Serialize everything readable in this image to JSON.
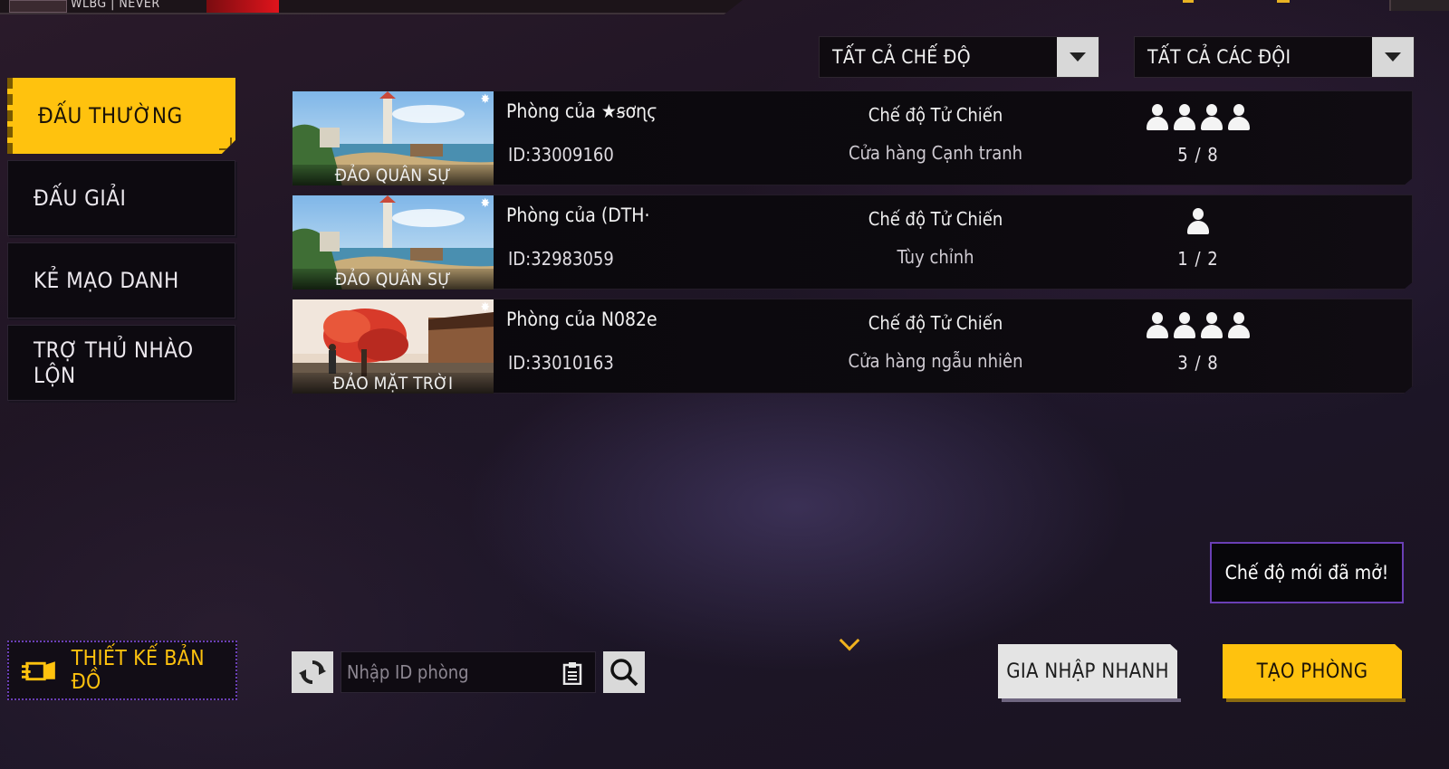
{
  "top_bar": {
    "name_text": "WLBG | NEVER"
  },
  "filters": {
    "mode": {
      "label": "TẤT CẢ CHẾ ĐỘ"
    },
    "team": {
      "label": "TẤT CẢ CÁC ĐỘI"
    }
  },
  "tabs": [
    {
      "label": "ĐẤU THƯỜNG",
      "active": true
    },
    {
      "label": "ĐẤU GIẢI",
      "active": false
    },
    {
      "label": "KẺ MẠO DANH",
      "active": false
    },
    {
      "label": "TRỢ THỦ NHÀO LỘN",
      "active": false
    }
  ],
  "rooms": [
    {
      "map": "ĐẢO QUÂN SỰ",
      "name": "Phòng của ★ꞩơɳϛ",
      "id": "ID:33009160",
      "mode": "Chế độ Tử Chiến",
      "shop": "Cửa hàng Cạnh tranh",
      "players": "5 / 8",
      "icon_count": 4
    },
    {
      "map": "ĐẢO QUÂN SỰ",
      "name": "Phòng của (DTH·",
      "id": "ID:32983059",
      "mode": "Chế độ Tử Chiến",
      "shop": "Tùy chỉnh",
      "players": "1 / 2",
      "icon_count": 1
    },
    {
      "map": "ĐẢO MẶT TRỜI",
      "name": "Phòng của N082e",
      "id": "ID:33010163",
      "mode": "Chế độ Tử Chiến",
      "shop": "Cửa hàng ngẫu nhiên",
      "players": "3 / 8",
      "icon_count": 4
    }
  ],
  "notice": {
    "text": "Chế độ mới đã mở!"
  },
  "bottom": {
    "map_design_label": "THIẾT KẾ BẢN ĐỒ",
    "search_placeholder": "Nhập ID phòng",
    "quick_join_label": "GIA NHẬP NHANH",
    "create_room_label": "TẠO PHÒNG"
  },
  "colors": {
    "accent": "#ffc20e",
    "purple_border": "#6a3fb5"
  },
  "icons": [
    "refresh-icon",
    "paste-icon",
    "search-icon",
    "map-design-icon",
    "chevron-down-icon",
    "person-icon",
    "sun-icon"
  ]
}
